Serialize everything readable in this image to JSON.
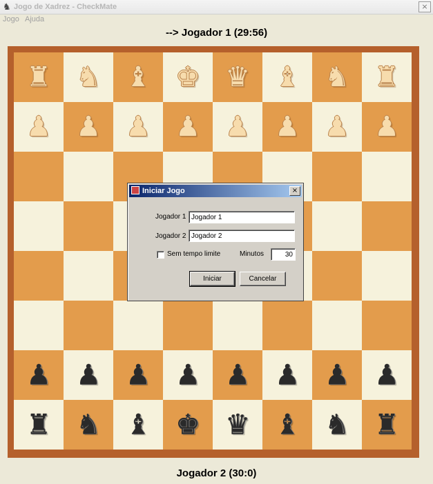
{
  "window": {
    "title": "Jogo de Xadrez - CheckMate",
    "close_label": "×"
  },
  "menu": [
    {
      "label": "Jogo"
    },
    {
      "label": "Ajuda"
    }
  ],
  "player_top": "--> Jogador 1 (29:56)",
  "player_bottom": "Jogador 2 (30:0)",
  "board": {
    "light_color": "#f6f2dc",
    "dark_color": "#e39c4c",
    "frame_color": "#b5602c",
    "white_pieces_color": "#f7dcad",
    "black_pieces_color": "#2a2a2a",
    "rows": [
      [
        "rook-white",
        "knight-white",
        "bishop-white",
        "king-white",
        "queen-white",
        "bishop-white",
        "knight-white",
        "rook-white"
      ],
      [
        "pawn-white",
        "pawn-white",
        "pawn-white",
        "pawn-white",
        "pawn-white",
        "pawn-white",
        "pawn-white",
        "pawn-white"
      ],
      [
        "",
        "",
        "",
        "",
        "",
        "",
        "",
        ""
      ],
      [
        "",
        "",
        "",
        "",
        "",
        "",
        "",
        ""
      ],
      [
        "",
        "",
        "",
        "",
        "",
        "",
        "",
        ""
      ],
      [
        "",
        "",
        "",
        "",
        "",
        "",
        "",
        ""
      ],
      [
        "pawn-black",
        "pawn-black",
        "pawn-black",
        "pawn-black",
        "pawn-black",
        "pawn-black",
        "pawn-black",
        "pawn-black"
      ],
      [
        "rook-black",
        "knight-black",
        "bishop-black",
        "king-black",
        "queen-black",
        "bishop-black",
        "knight-black",
        "rook-black"
      ]
    ]
  },
  "dialog": {
    "title": "Iniciar Jogo",
    "close_label": "×",
    "player1_label": "Jogador 1",
    "player1_value": "Jogador 1",
    "player2_label": "Jogador 2",
    "player2_value": "Jogador 2",
    "no_time_limit_label": "Sem tempo limite",
    "no_time_limit_checked": false,
    "minutes_label": "Minutos",
    "minutes_value": "30",
    "start_button": "Iniciar",
    "cancel_button": "Cancelar"
  }
}
